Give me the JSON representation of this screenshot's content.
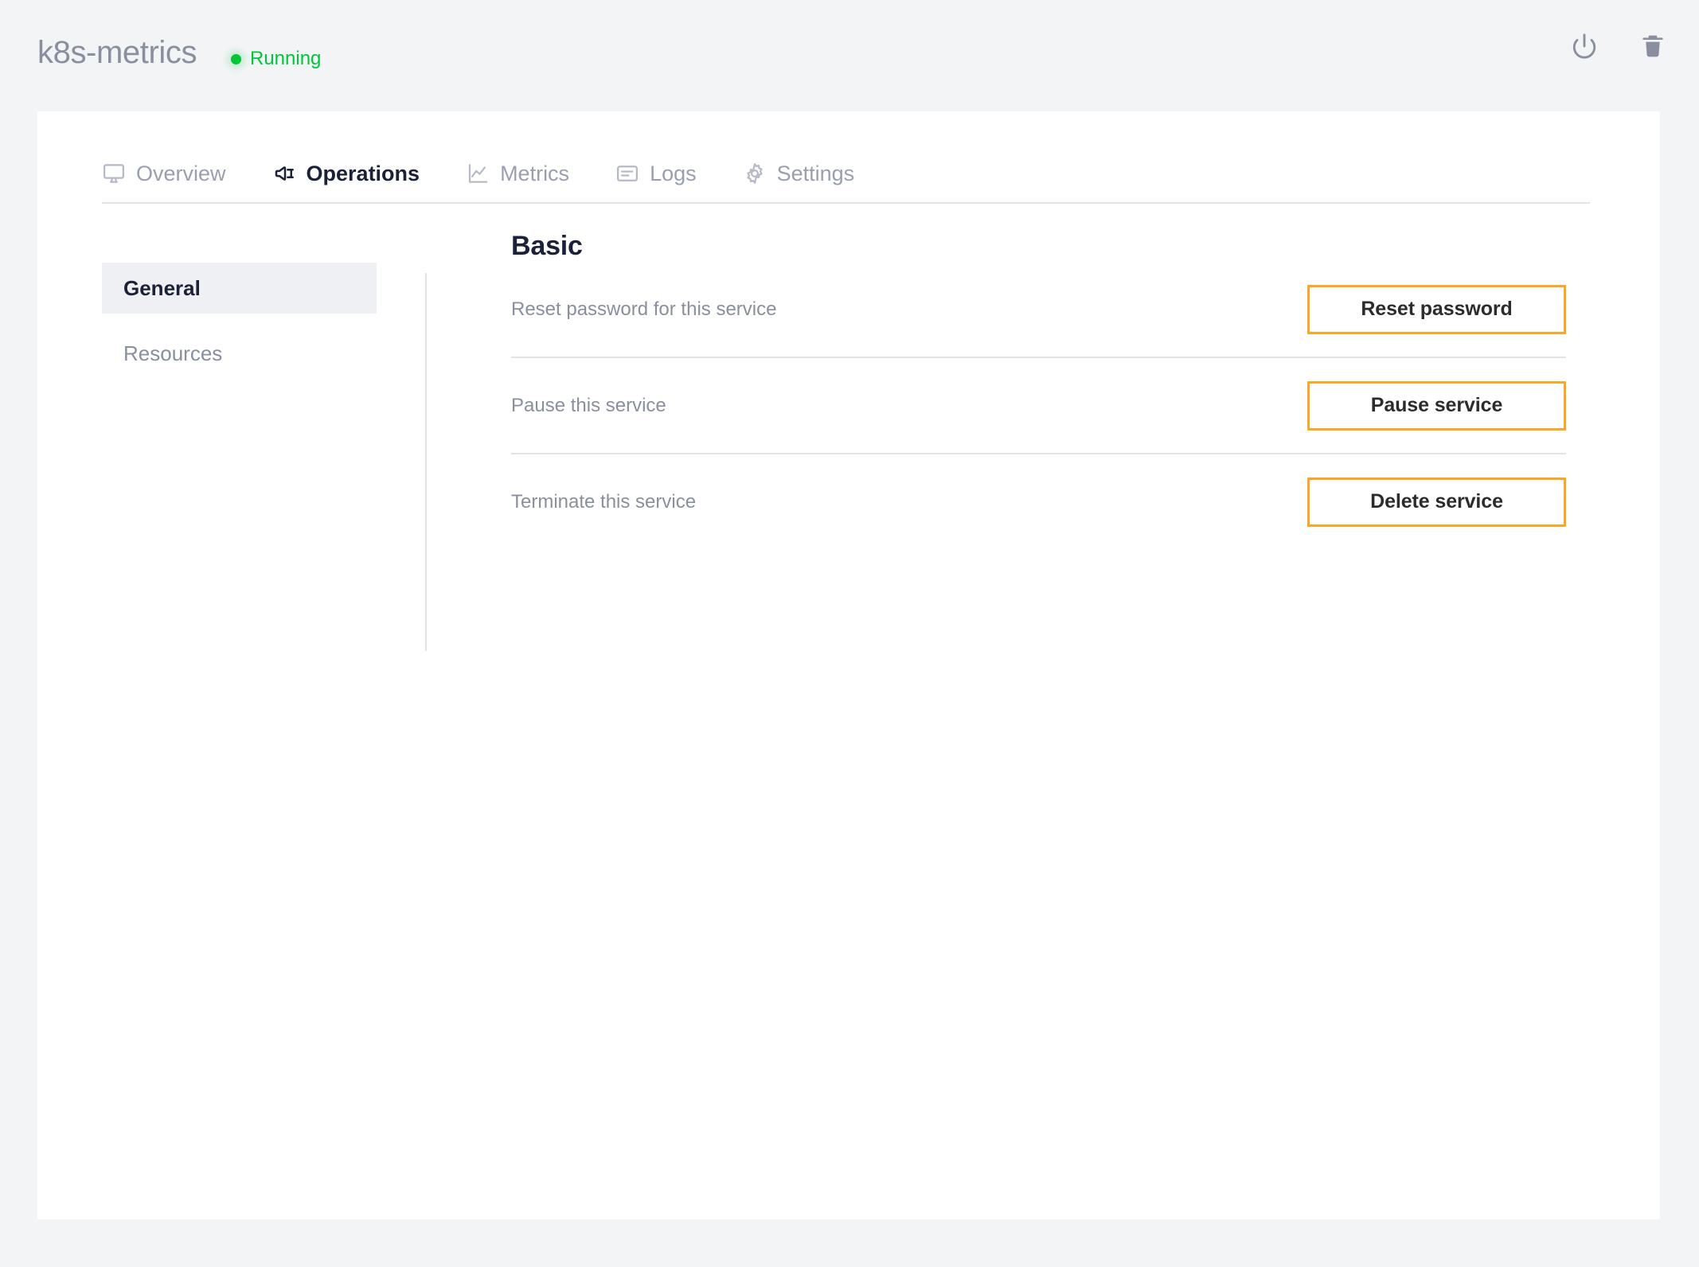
{
  "header": {
    "title": "k8s-metrics",
    "status": {
      "label": "Running",
      "color": "#00c638",
      "icon": "status-dot-icon"
    },
    "actions": [
      {
        "name": "power-icon",
        "tooltip": "Power"
      },
      {
        "name": "trash-icon",
        "tooltip": "Delete"
      }
    ]
  },
  "tabs": [
    {
      "label": "Overview",
      "icon": "monitor-icon",
      "active": false
    },
    {
      "label": "Operations",
      "icon": "plug-icon",
      "active": true
    },
    {
      "label": "Metrics",
      "icon": "line-chart-icon",
      "active": false
    },
    {
      "label": "Logs",
      "icon": "document-icon",
      "active": false
    },
    {
      "label": "Settings",
      "icon": "gear-icon",
      "active": false
    }
  ],
  "subnav": [
    {
      "label": "General",
      "active": true
    },
    {
      "label": "Resources",
      "active": false
    }
  ],
  "panel": {
    "title": "Basic",
    "rows": [
      {
        "label": "Reset password for this service",
        "button": "Reset password"
      },
      {
        "label": "Pause this service",
        "button": "Pause service"
      },
      {
        "label": "Terminate this service",
        "button": "Delete service"
      }
    ]
  },
  "colors": {
    "page_background": "#f2f4f6",
    "card_background": "#ffffff",
    "accent_button_border": "#f9a825",
    "status_green": "#00c638",
    "text_muted": "#8a8fa0",
    "text_dark": "#1b2237",
    "divider": "#e2e4ea",
    "subnav_active_bg": "#eef0f3"
  }
}
